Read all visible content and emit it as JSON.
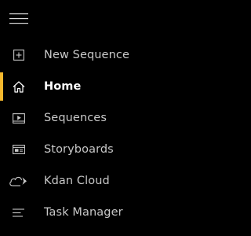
{
  "nav": {
    "menu_button": {
      "icon": "hamburger-menu-icon"
    },
    "accent_color": "#f5b82e",
    "items": [
      {
        "label": "New Sequence",
        "icon": "plus-square-icon",
        "selected": false
      },
      {
        "label": "Home",
        "icon": "home-icon",
        "selected": true
      },
      {
        "label": "Sequences",
        "icon": "play-frame-icon",
        "selected": false
      },
      {
        "label": "Storyboards",
        "icon": "storyboard-icon",
        "selected": false
      },
      {
        "label": "Kdan Cloud",
        "icon": "cloud-icon",
        "selected": false
      },
      {
        "label": "Task Manager",
        "icon": "task-list-icon",
        "selected": false
      }
    ]
  }
}
